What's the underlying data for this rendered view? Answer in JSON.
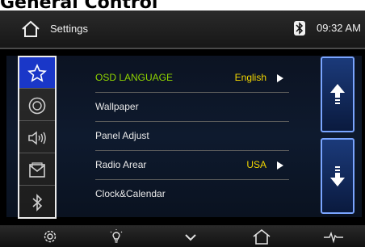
{
  "caption": "General Control",
  "statusbar": {
    "title": "Settings",
    "time": "09:32 AM"
  },
  "sidebar": {
    "items": [
      {
        "name": "favorite",
        "icon": "star-icon",
        "active": true
      },
      {
        "name": "disc",
        "icon": "disc-icon",
        "active": false
      },
      {
        "name": "sound",
        "icon": "speaker-icon",
        "active": false
      },
      {
        "name": "mail",
        "icon": "envelope-icon",
        "active": false
      },
      {
        "name": "bluetooth",
        "icon": "bluetooth-icon",
        "active": false
      }
    ]
  },
  "settings": {
    "rows": [
      {
        "label": "OSD LANGUAGE",
        "value": "English",
        "highlight": true
      },
      {
        "label": "Wallpaper",
        "value": ""
      },
      {
        "label": "Panel Adjust",
        "value": ""
      },
      {
        "label": "Radio Arear",
        "value": "USA"
      },
      {
        "label": "Clock&Calendar",
        "value": ""
      }
    ]
  },
  "bottombar": {
    "icons": [
      "gear-icon",
      "bulb-icon",
      "chevron-down-icon",
      "home-icon",
      "pulse-icon"
    ]
  },
  "colors": {
    "highlight_label": "#8fd400",
    "value_text": "#f2d600",
    "active_tab": "#1a37c8",
    "scroll_border": "#7aa5ff"
  }
}
